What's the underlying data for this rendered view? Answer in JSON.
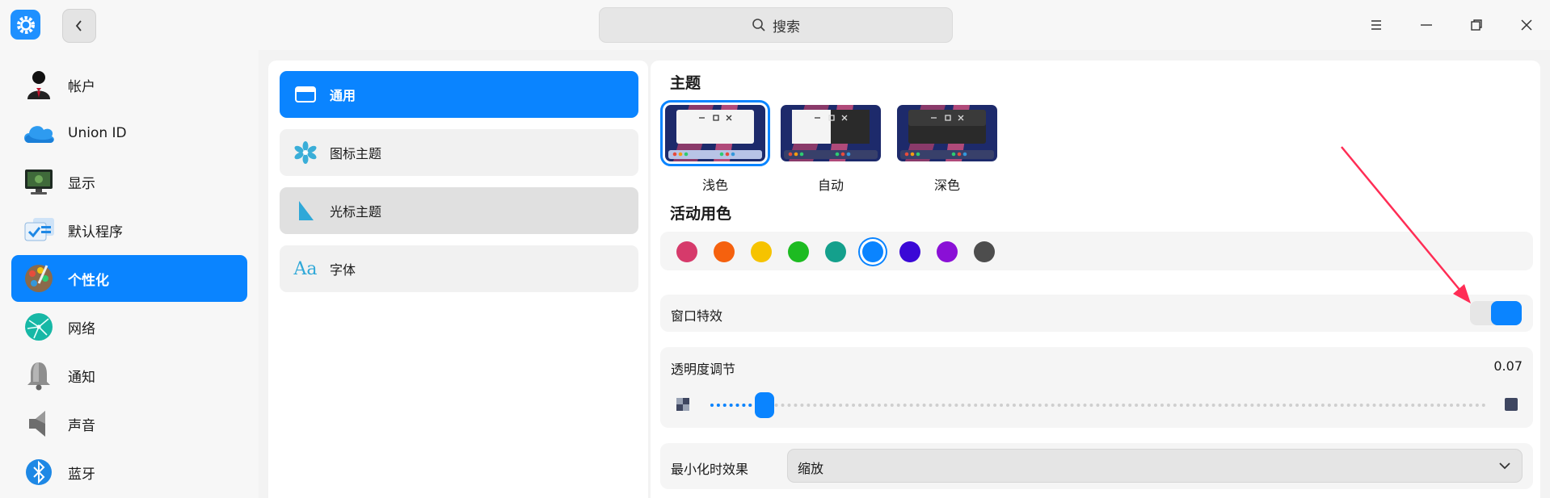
{
  "titlebar": {
    "search_placeholder": "搜索",
    "icons": [
      "settings-gear-icon",
      "back-chevron-icon",
      "search-icon",
      "menu-icon",
      "minimize-icon",
      "maximize-icon",
      "close-icon"
    ]
  },
  "sidebar": {
    "items": [
      {
        "label": "帐户",
        "icon": "account-avatar-icon"
      },
      {
        "label": "Union ID",
        "icon": "cloud-icon"
      },
      {
        "label": "显示",
        "icon": "display-monitor-icon"
      },
      {
        "label": "默认程序",
        "icon": "default-apps-icon"
      },
      {
        "label": "个性化",
        "icon": "personalization-icon",
        "active": true
      },
      {
        "label": "网络",
        "icon": "network-icon"
      },
      {
        "label": "通知",
        "icon": "notification-bell-icon"
      },
      {
        "label": "声音",
        "icon": "speaker-icon"
      },
      {
        "label": "蓝牙",
        "icon": "bluetooth-icon"
      }
    ]
  },
  "middle": {
    "items": [
      {
        "label": "通用",
        "icon": "window-icon",
        "active": true
      },
      {
        "label": "图标主题",
        "icon": "icon-theme-flower-icon"
      },
      {
        "label": "光标主题",
        "icon": "cursor-icon",
        "hover": true
      },
      {
        "label": "字体",
        "icon": "font-aa-icon"
      }
    ]
  },
  "content": {
    "theme_title": "主题",
    "themes": [
      {
        "label": "浅色",
        "selected": true
      },
      {
        "label": "自动"
      },
      {
        "label": "深色"
      }
    ],
    "accent_title": "活动用色",
    "accent_colors": [
      "#d63a6b",
      "#f5610e",
      "#f6c300",
      "#1dbb21",
      "#14a08c",
      "#0a84ff",
      "#3a08d6",
      "#8a10d6",
      "#4d4d4d"
    ],
    "accent_selected_index": 5,
    "window_effect_label": "窗口特效",
    "window_effect_on": true,
    "transparency_label": "透明度调节",
    "transparency_value": "0.07",
    "transparency_fraction": 0.07,
    "minimize_label": "最小化时效果",
    "minimize_value": "缩放"
  },
  "colors": {
    "accent": "#0a84ff",
    "annotation_arrow": "#ff2d55"
  }
}
